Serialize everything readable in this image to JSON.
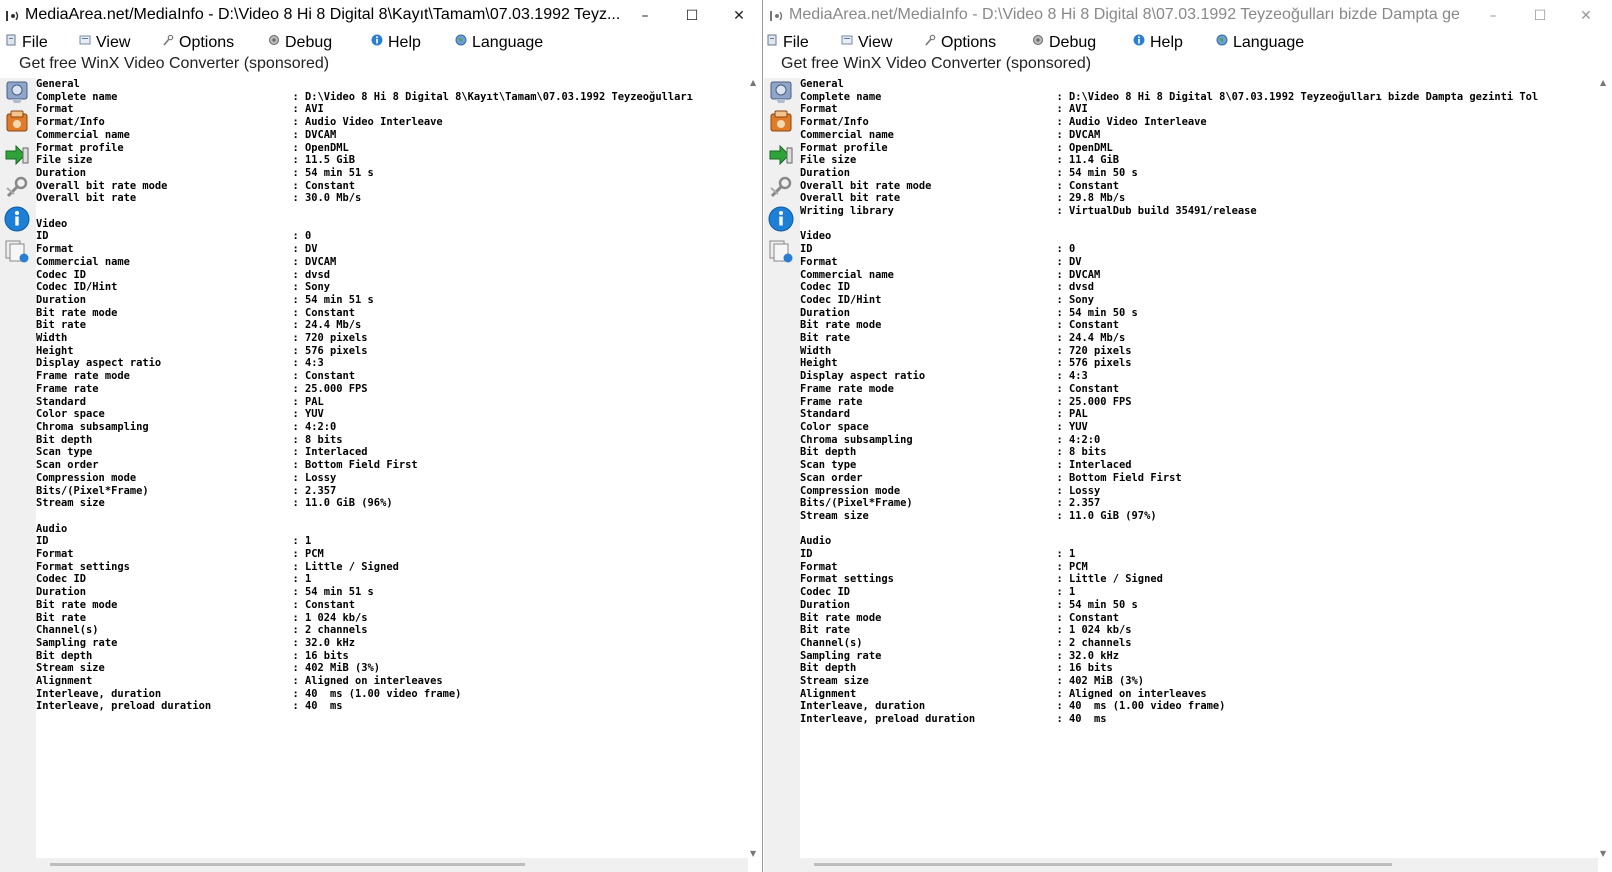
{
  "left": {
    "title": "MediaArea.net/MediaInfo - D:\\Video 8 Hi 8 Digital 8\\Kayıt\\Tamam\\07.03.1992 Teyz...",
    "window_buttons": {
      "minimize": "–",
      "maximize": "☐",
      "close": "✕"
    },
    "menu": [
      "File",
      "View",
      "Options",
      "Debug",
      "Help",
      "Language"
    ],
    "sponsor": "Get free WinX Video Converter (sponsored)",
    "info_lines": [
      "General",
      "Complete name                            : D:\\Video 8 Hi 8 Digital 8\\Kayıt\\Tamam\\07.03.1992 Teyzeoğulları",
      "Format                                   : AVI",
      "Format/Info                              : Audio Video Interleave",
      "Commercial name                          : DVCAM",
      "Format profile                           : OpenDML",
      "File size                                : 11.5 GiB",
      "Duration                                 : 54 min 51 s",
      "Overall bit rate mode                    : Constant",
      "Overall bit rate                         : 30.0 Mb/s",
      "",
      "Video",
      "ID                                       : 0",
      "Format                                   : DV",
      "Commercial name                          : DVCAM",
      "Codec ID                                 : dvsd",
      "Codec ID/Hint                            : Sony",
      "Duration                                 : 54 min 51 s",
      "Bit rate mode                            : Constant",
      "Bit rate                                 : 24.4 Mb/s",
      "Width                                    : 720 pixels",
      "Height                                   : 576 pixels",
      "Display aspect ratio                     : 4:3",
      "Frame rate mode                          : Constant",
      "Frame rate                               : 25.000 FPS",
      "Standard                                 : PAL",
      "Color space                              : YUV",
      "Chroma subsampling                       : 4:2:0",
      "Bit depth                                : 8 bits",
      "Scan type                                : Interlaced",
      "Scan order                               : Bottom Field First",
      "Compression mode                         : Lossy",
      "Bits/(Pixel*Frame)                       : 2.357",
      "Stream size                              : 11.0 GiB (96%)",
      "",
      "Audio",
      "ID                                       : 1",
      "Format                                   : PCM",
      "Format settings                          : Little / Signed",
      "Codec ID                                 : 1",
      "Duration                                 : 54 min 51 s",
      "Bit rate mode                            : Constant",
      "Bit rate                                 : 1 024 kb/s",
      "Channel(s)                               : 2 channels",
      "Sampling rate                            : 32.0 kHz",
      "Bit depth                                : 16 bits",
      "Stream size                              : 402 MiB (3%)",
      "Alignment                                : Aligned on interleaves",
      "Interleave, duration                     : 40  ms (1.00 video frame)",
      "Interleave, preload duration             : 40  ms"
    ]
  },
  "right": {
    "title": "MediaArea.net/MediaInfo - D:\\Video 8 Hi 8 Digital 8\\07.03.1992 Teyzeoğulları bizde Dampta ge...",
    "window_buttons": {
      "minimize": "–",
      "maximize": "☐",
      "close": "✕"
    },
    "menu": [
      "File",
      "View",
      "Options",
      "Debug",
      "Help",
      "Language"
    ],
    "sponsor": "Get free WinX Video Converter (sponsored)",
    "info_lines": [
      "General",
      "Complete name                            : D:\\Video 8 Hi 8 Digital 8\\07.03.1992 Teyzeoğulları bizde Dampta gezinti Tol",
      "Format                                   : AVI",
      "Format/Info                              : Audio Video Interleave",
      "Commercial name                          : DVCAM",
      "Format profile                           : OpenDML",
      "File size                                : 11.4 GiB",
      "Duration                                 : 54 min 50 s",
      "Overall bit rate mode                    : Constant",
      "Overall bit rate                         : 29.8 Mb/s",
      "Writing library                          : VirtualDub build 35491/release",
      "",
      "Video",
      "ID                                       : 0",
      "Format                                   : DV",
      "Commercial name                          : DVCAM",
      "Codec ID                                 : dvsd",
      "Codec ID/Hint                            : Sony",
      "Duration                                 : 54 min 50 s",
      "Bit rate mode                            : Constant",
      "Bit rate                                 : 24.4 Mb/s",
      "Width                                    : 720 pixels",
      "Height                                   : 576 pixels",
      "Display aspect ratio                     : 4:3",
      "Frame rate mode                          : Constant",
      "Frame rate                               : 25.000 FPS",
      "Standard                                 : PAL",
      "Color space                              : YUV",
      "Chroma subsampling                       : 4:2:0",
      "Bit depth                                : 8 bits",
      "Scan type                                : Interlaced",
      "Scan order                               : Bottom Field First",
      "Compression mode                         : Lossy",
      "Bits/(Pixel*Frame)                       : 2.357",
      "Stream size                              : 11.0 GiB (97%)",
      "",
      "Audio",
      "ID                                       : 1",
      "Format                                   : PCM",
      "Format settings                          : Little / Signed",
      "Codec ID                                 : 1",
      "Duration                                 : 54 min 50 s",
      "Bit rate mode                            : Constant",
      "Bit rate                                 : 1 024 kb/s",
      "Channel(s)                               : 2 channels",
      "Sampling rate                            : 32.0 kHz",
      "Bit depth                                : 16 bits",
      "Stream size                              : 402 MiB (3%)",
      "Alignment                                : Aligned on interleaves",
      "Interleave, duration                     : 40  ms (1.00 video frame)",
      "Interleave, preload duration             : 40  ms"
    ]
  },
  "icons": {
    "menu": [
      "file-icon",
      "view-icon",
      "options-icon",
      "debug-icon",
      "help-icon",
      "language-icon"
    ],
    "sidebar": [
      "easy-view-icon",
      "sheet-view-icon",
      "export-icon",
      "preferences-icon",
      "about-icon",
      "batch-files-icon"
    ]
  },
  "colors": {
    "window_bg": "#ffffff",
    "panel_bg": "#f0f0f0",
    "inactive_title": "#888888",
    "about_icon_blue": "#1e7fd6"
  }
}
